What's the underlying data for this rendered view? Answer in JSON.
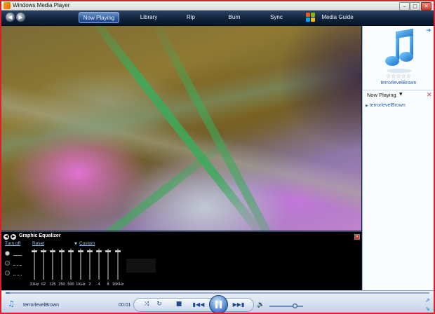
{
  "window": {
    "title": "Windows Media Player"
  },
  "nav": {
    "tabs": [
      {
        "label": "Now Playing"
      },
      {
        "label": "Library"
      },
      {
        "label": "Rip"
      },
      {
        "label": "Burn"
      },
      {
        "label": "Sync"
      },
      {
        "label": "Media Guide"
      }
    ],
    "active_tab": "Now Playing"
  },
  "right_panel": {
    "artist": "terrorlevelBrown",
    "rating_stars": 0,
    "rating_max": 5,
    "playlist_label": "Now Playing",
    "playlist_items": [
      {
        "label": "terrorlevelBrown"
      }
    ]
  },
  "equalizer": {
    "title": "Graphic Equalizer",
    "turn_off": "Turn off",
    "reset": "Reset",
    "preset": "Custom",
    "bands": [
      {
        "label": "31Hz"
      },
      {
        "label": "62"
      },
      {
        "label": "125"
      },
      {
        "label": "250"
      },
      {
        "label": "500"
      },
      {
        "label": "1KHz"
      },
      {
        "label": "2"
      },
      {
        "label": "4"
      },
      {
        "label": "8"
      },
      {
        "label": "16KHz"
      }
    ]
  },
  "player": {
    "track_name": "terrorlevelBrown",
    "time": "00:01",
    "seek_progress": 0.01,
    "volume": 0.75,
    "state": "playing"
  },
  "colors": {
    "frame_border": "#d4232b",
    "nav_bg": "#0f2038",
    "accent": "#2660b3",
    "link": "#9ec6f3"
  },
  "icons": {
    "back": "back-arrow-icon",
    "forward": "forward-arrow-icon",
    "music": "music-note-icon",
    "shuffle": "shuffle-icon",
    "repeat": "repeat-icon",
    "stop": "stop-icon",
    "previous": "previous-icon",
    "pause": "pause-icon",
    "next": "next-icon",
    "volume": "volume-icon"
  }
}
